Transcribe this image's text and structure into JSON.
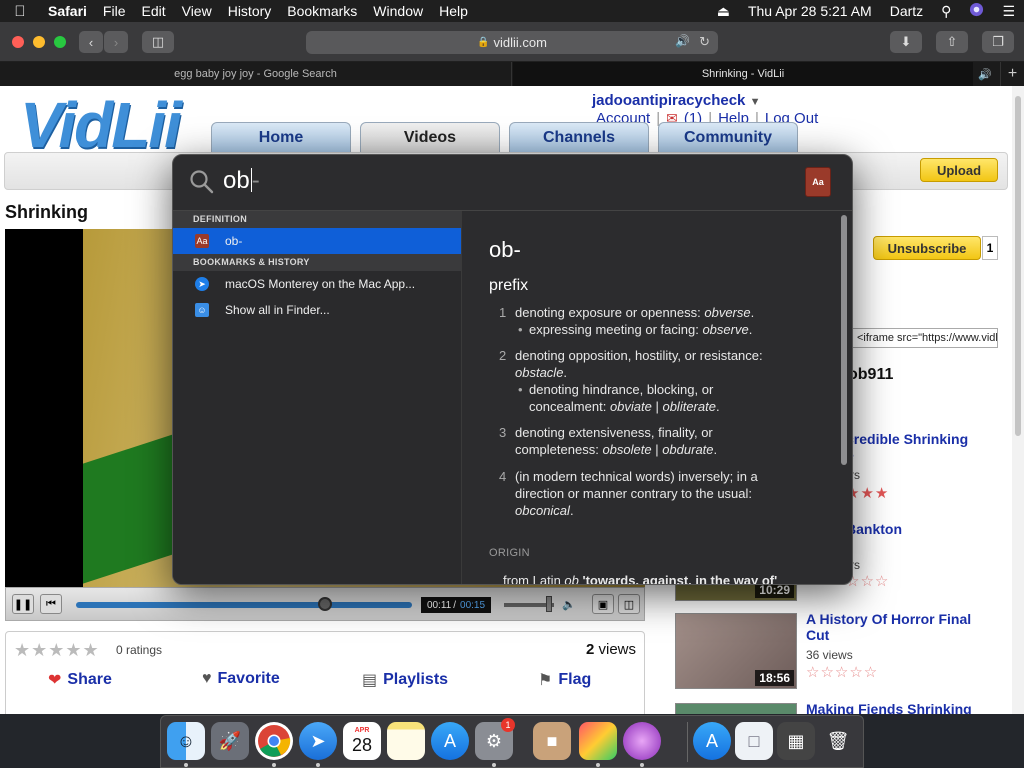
{
  "menubar": {
    "apple": "",
    "app": "Safari",
    "items": [
      "File",
      "Edit",
      "View",
      "History",
      "Bookmarks",
      "Window",
      "Help"
    ],
    "datetime": "Thu Apr 28  5:21 AM",
    "user": "Dartz"
  },
  "browser": {
    "url": "vidlii.com",
    "tabs": [
      {
        "title": "egg baby joy joy - Google Search"
      },
      {
        "title": "Shrinking - VidLii"
      }
    ],
    "new_tab": "+"
  },
  "site": {
    "logo": "VidLii",
    "username": "jadooantipiracycheck",
    "account": "Account",
    "notifications": "(1)",
    "help": "Help",
    "logout": "Log Out",
    "nav": [
      "Home",
      "Videos",
      "Channels",
      "Community"
    ],
    "upload": "Upload"
  },
  "video": {
    "title": "Shrinking",
    "time_current": "00:11",
    "time_sep": "/",
    "time_total": "00:15",
    "progress_fraction": 0.74,
    "ratings": "0 ratings",
    "views_count": "2",
    "views_label": "views",
    "actions": [
      "Share",
      "Favorite",
      "Playlists",
      "Flag"
    ]
  },
  "sidebar": {
    "unsubscribe": "Unsubscribe",
    "sub_count": "1",
    "embed": "<iframe src=\"https://www.vidlii.com/embed",
    "channel_fragment": "ob911",
    "related": [
      {
        "title_line1": "credible Shrinking",
        "title_line2": "e",
        "views": "rs",
        "duration": ""
      },
      {
        "title_line1": "Bankton",
        "title_line2": "",
        "views": "rs",
        "duration": "10:29"
      },
      {
        "title_line1": "A History Of Horror Final",
        "title_line2": "Cut",
        "views": "36 views",
        "duration": "18:56"
      },
      {
        "title_line1": "Making Fiends Shrinking",
        "title_line2": "",
        "views": "",
        "duration": ""
      }
    ]
  },
  "spotlight": {
    "query": "ob",
    "query_hint": "-",
    "sections": [
      {
        "header": "DEFINITION",
        "items": [
          {
            "label": "ob-"
          }
        ]
      },
      {
        "header": "BOOKMARKS & HISTORY",
        "items": [
          {
            "label": "macOS Monterey on the Mac App..."
          },
          {
            "label": "Show all in Finder..."
          }
        ]
      }
    ],
    "detail": {
      "word": "ob-",
      "pos": "prefix",
      "d1": "denoting exposure or openness: ",
      "d1_ex": "obverse",
      "d1_sub": "expressing meeting or facing: ",
      "d1_sub_ex": "observe",
      "d2": "denoting opposition, hostility, or resistance:",
      "d2_ex": "obstacle",
      "d2_sub": "denoting hindrance, blocking, or",
      "d2_sub2": "concealment: ",
      "d2_sub_ex1": "obviate",
      "d2_sub_ex2": "obliterate",
      "d3": "denoting extensiveness, finality, or",
      "d3_2": "completeness: ",
      "d3_ex1": "obsolete",
      "d3_ex2": "obdurate",
      "d4": "(in modern technical words) inversely; in a",
      "d4_2": "direction or manner contrary to the usual:",
      "d4_ex": "obconical",
      "origin_header": "ORIGIN",
      "origin": "from Latin ",
      "origin_word": "ob",
      "origin_gloss": " 'towards, against, in the way of'"
    }
  },
  "dock": {
    "calendar_month": "APR",
    "calendar_day": "28",
    "badge": "1"
  }
}
